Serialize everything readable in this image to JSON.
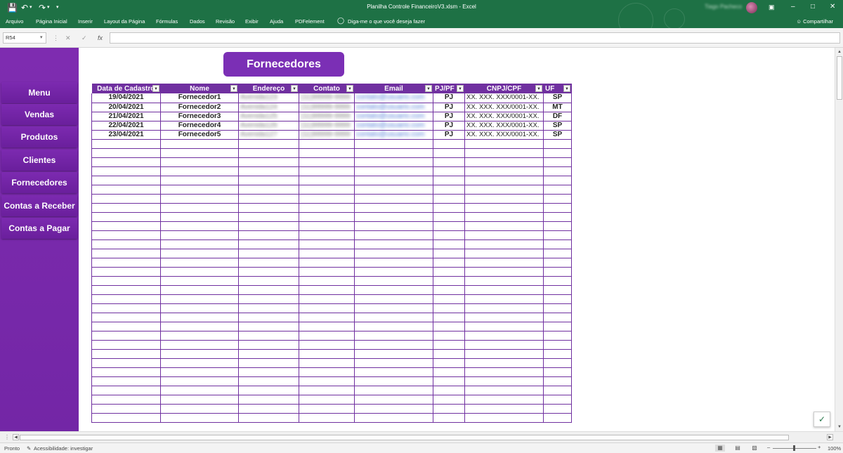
{
  "titlebar": {
    "title": "Planilha Controle FinanceiroV3.xlsm  -  Excel",
    "user_name": "Tiago Pacheco",
    "save_icon": "save-icon",
    "undo_icon": "undo-icon",
    "redo_icon": "redo-icon",
    "minimize": "–",
    "restore": "□",
    "close": "✕"
  },
  "ribbon": {
    "tabs": [
      "Arquivo",
      "Página Inicial",
      "Inserir",
      "Layout da Página",
      "Fórmulas",
      "Dados",
      "Revisão",
      "Exibir",
      "Ajuda",
      "PDFelement"
    ],
    "tell_me": "Diga-me o que você deseja fazer",
    "share": "Compartilhar"
  },
  "formula_bar": {
    "namebox": "R54",
    "fx": "fx",
    "cancel": "✕",
    "enter": "✓",
    "value": ""
  },
  "sidebar": {
    "items": [
      "Menu",
      "Vendas",
      "Produtos",
      "Clientes",
      "Fornecedores",
      "Contas a Receber",
      "Contas a Pagar"
    ]
  },
  "sheet": {
    "title": "Fornecedores"
  },
  "table": {
    "headers": [
      "Data de Cadastro",
      "Nome",
      "Endereço",
      "Contato",
      "Email",
      "PJ/PF",
      "CNPJ/CPF",
      "UF"
    ],
    "rows": [
      [
        "19/04/2021",
        "Fornecedor1",
        "Avenida123",
        "(11)99999-9999",
        "contato@usuario.com",
        "PJ",
        "XX. XXX. XXX/0001-XX.",
        "SP"
      ],
      [
        "20/04/2021",
        "Fornecedor2",
        "Avenida124",
        "(11)99999-9999",
        "contato@usuario.com",
        "PJ",
        "XX. XXX. XXX/0001-XX.",
        "MT"
      ],
      [
        "21/04/2021",
        "Fornecedor3",
        "Avenida125",
        "(11)99999-9999",
        "contato@usuario.com",
        "PJ",
        "XX. XXX. XXX/0001-XX.",
        "DF"
      ],
      [
        "22/04/2021",
        "Fornecedor4",
        "Avenida126",
        "(11)99999-9999",
        "contato@usuario.com",
        "PJ",
        "XX. XXX. XXX/0001-XX.",
        "SP"
      ],
      [
        "23/04/2021",
        "Fornecedor5",
        "Avenida127",
        "(11)99999-9999",
        "contato@usuario.com",
        "PJ",
        "XX. XXX. XXX/0001-XX.",
        "SP"
      ]
    ],
    "empty_rows": 31
  },
  "statusbar": {
    "ready": "Pronto",
    "accessibility": "Acessibilidade: investigar",
    "zoom": "100%",
    "zoom_out": "–",
    "zoom_in": "+"
  },
  "colors": {
    "excel_green": "#1e7145",
    "purple": "#7030a0",
    "sidebar_purple": "#7e2cb0"
  }
}
